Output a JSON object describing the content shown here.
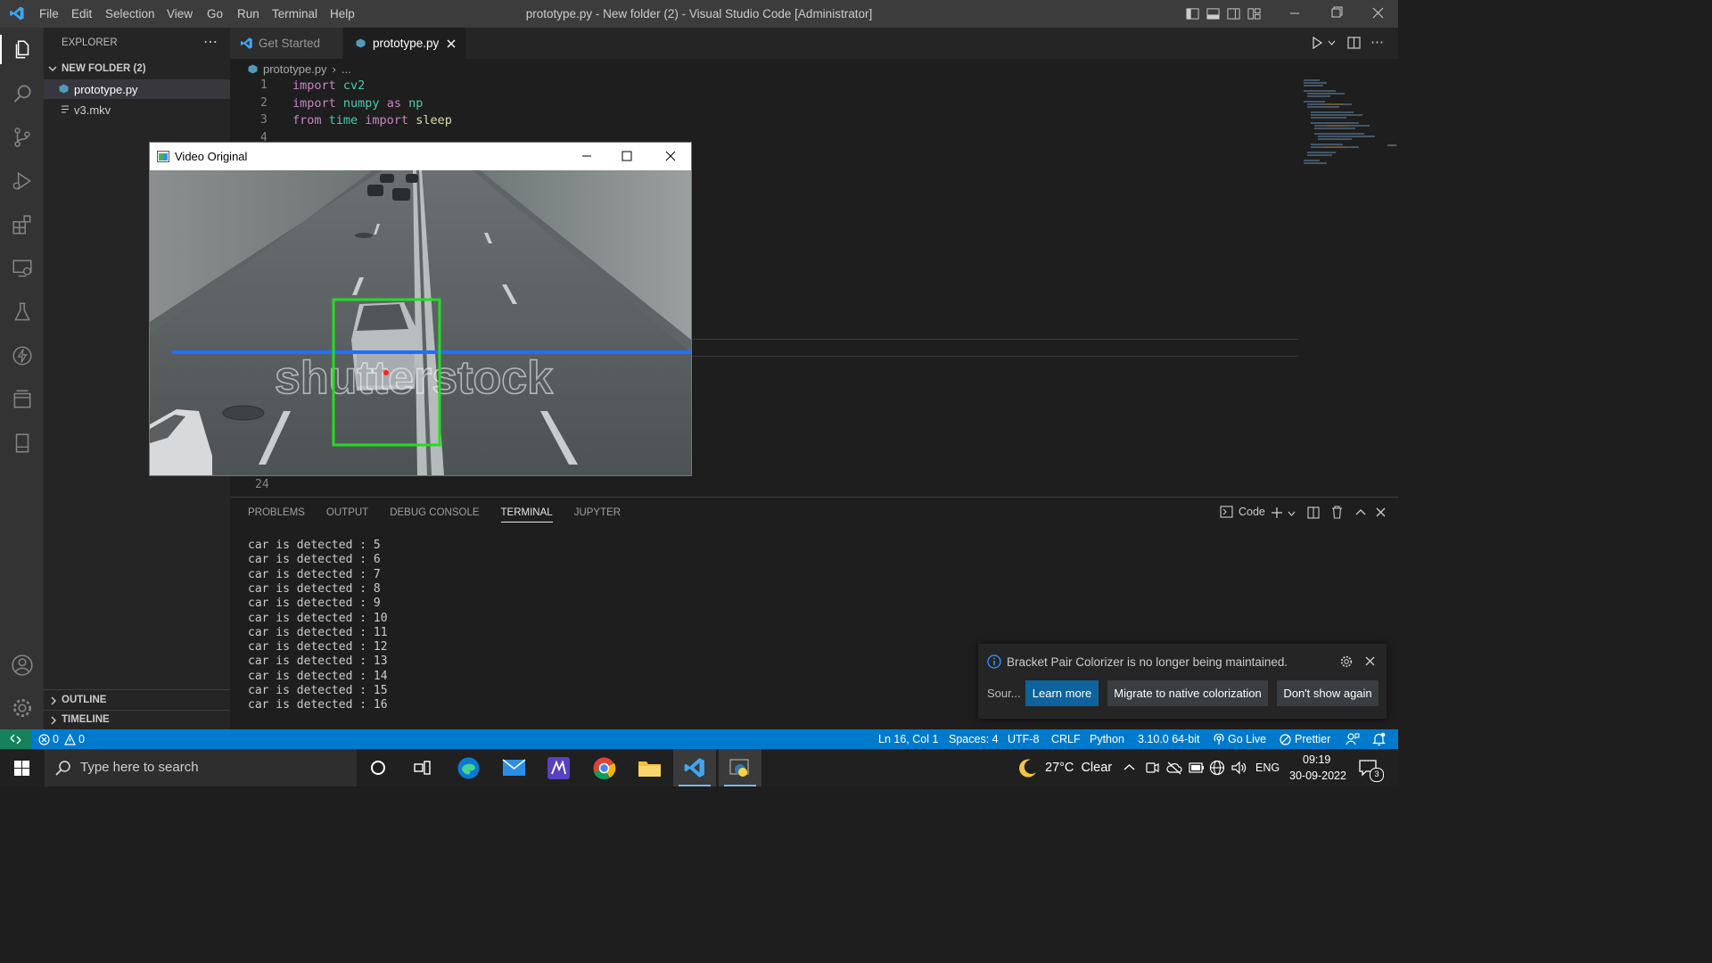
{
  "titlebar": {
    "menus": [
      "File",
      "Edit",
      "Selection",
      "View",
      "Go",
      "Run",
      "Terminal",
      "Help"
    ],
    "title": "prototype.py - New folder (2) - Visual Studio Code [Administrator]"
  },
  "sidebar": {
    "header": "EXPLORER",
    "folder": "NEW FOLDER (2)",
    "files": [
      "prototype.py",
      "v3.mkv"
    ],
    "outline": "OUTLINE",
    "timeline": "TIMELINE"
  },
  "tabs": [
    {
      "label": "Get Started",
      "active": false
    },
    {
      "label": "prototype.py",
      "active": true
    }
  ],
  "breadcrumb": {
    "file": "prototype.py",
    "rest": "..."
  },
  "editor": {
    "lines": [
      {
        "num": "1",
        "tokens": [
          [
            "import",
            "#c586c0"
          ],
          [
            " cv2",
            "#4ec9b0"
          ]
        ]
      },
      {
        "num": "2",
        "tokens": [
          [
            "import",
            "#c586c0"
          ],
          [
            " numpy",
            "#4ec9b0"
          ],
          [
            " as",
            "#c586c0"
          ],
          [
            " np",
            "#4ec9b0"
          ]
        ]
      },
      {
        "num": "3",
        "tokens": [
          [
            "from",
            "#c586c0"
          ],
          [
            " time",
            "#4ec9b0"
          ],
          [
            " import",
            "#c586c0"
          ],
          [
            " sleep",
            "#dcdcaa"
          ]
        ]
      },
      {
        "num": "4",
        "tokens": []
      }
    ],
    "last_line_num": "24"
  },
  "video_window": {
    "title": "Video Original",
    "watermark": "shutterstock"
  },
  "panel": {
    "tabs": [
      "PROBLEMS",
      "OUTPUT",
      "DEBUG CONSOLE",
      "TERMINAL",
      "JUPYTER"
    ],
    "active_tab": "TERMINAL",
    "terminal_name": "Code",
    "terminal_lines": [
      "car is detected : 5",
      "car is detected : 6",
      "car is detected : 7",
      "car is detected : 8",
      "car is detected : 9",
      "car is detected : 10",
      "car is detected : 11",
      "car is detected : 12",
      "car is detected : 13",
      "car is detected : 14",
      "car is detected : 15",
      "car is detected : 16"
    ]
  },
  "notification": {
    "message": "Bracket Pair Colorizer is no longer being maintained.",
    "source": "Sour...",
    "buttons": [
      "Learn more",
      "Migrate to native colorization",
      "Don't show again"
    ]
  },
  "statusbar": {
    "errors": "0",
    "warnings": "0",
    "position": "Ln 16, Col 1",
    "spaces": "Spaces: 4",
    "encoding": "UTF-8",
    "eol": "CRLF",
    "language": "Python",
    "interpreter": "3.10.0 64-bit",
    "golive": "Go Live",
    "prettier": "Prettier"
  },
  "taskbar": {
    "search_placeholder": "Type here to search",
    "weather": "27°C  Clear",
    "language": "ENG",
    "time": "09:19",
    "date": "30-09-2022",
    "notification_count": "3"
  },
  "colors": {
    "accent": "#007acc",
    "detection_box": "#22dd22",
    "count_line": "#1e6fff"
  }
}
